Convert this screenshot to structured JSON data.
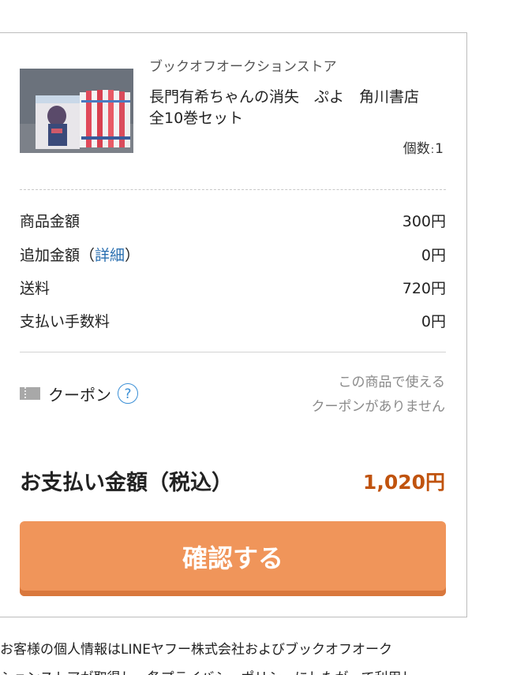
{
  "product": {
    "store_name": "ブックオフオークションストア",
    "title_line1": "長門有希ちゃんの消失　ぷよ　角川書店",
    "title_line2": "全10巻セット",
    "quantity_label": "個数",
    "quantity_value": "1"
  },
  "pricing": {
    "rows": [
      {
        "label": "商品金額",
        "value": "300円"
      },
      {
        "label": "追加金額",
        "value": "0円",
        "link_text": "詳細"
      },
      {
        "label": "送料",
        "value": "720円"
      },
      {
        "label": "支払い手数料",
        "value": "0円"
      }
    ]
  },
  "coupon": {
    "label": "クーポン",
    "help": "?",
    "note_line1": "この商品で使える",
    "note_line2": "クーポンがありません"
  },
  "total": {
    "label": "お支払い金額（税込）",
    "value": "1,020円"
  },
  "confirm_button": {
    "label": "確認する"
  },
  "footer": {
    "line1": "お客様の個人情報はLINEヤフー株式会社およびブックオフオーク",
    "line2": "ションストアが取得し、各プライバシーポリシーにしたがって利用し"
  },
  "colors": {
    "accent_button": "#f0955a",
    "total_price": "#c0530e",
    "link": "#2a6fb0",
    "help_icon": "#3a8fd6"
  },
  "icons": [
    "coupon-ticket-icon",
    "help-question-icon"
  ]
}
